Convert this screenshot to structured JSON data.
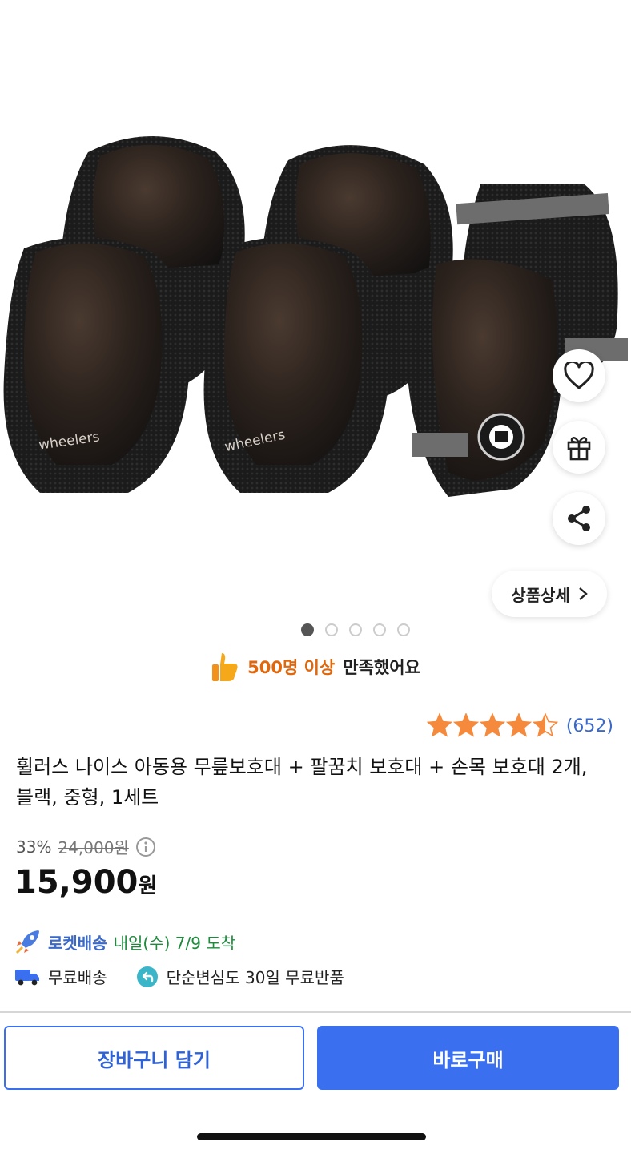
{
  "product_image": {
    "brand_mark_1": "wheelers",
    "brand_mark_2": "wheelers"
  },
  "actions": {
    "wishlist_icon": "heart-icon",
    "gift_icon": "gift-icon",
    "share_icon": "share-icon",
    "detail_label": "상품상세"
  },
  "carousel": {
    "count": 5,
    "active_index": 0
  },
  "satisfaction": {
    "highlight": "500명 이상",
    "rest": "만족했어요"
  },
  "rating": {
    "stars": 4.5,
    "count_text": "(652)"
  },
  "product": {
    "title": "휠러스 나이스 아동용 무릎보호대 + 팔꿈치 보호대 + 손목 보호대 2개, 블랙, 중형, 1세트"
  },
  "price": {
    "discount": "33%",
    "original": "24,000원",
    "current": "15,900",
    "currency": "원"
  },
  "delivery": {
    "brand": "로켓배송",
    "eta": "내일(수) 7/9 도착",
    "free_shipping": "무료배송",
    "return_policy": "단순변심도 30일 무료반품"
  },
  "buttons": {
    "cart": "장바구니 담기",
    "buy": "바로구매"
  },
  "colors": {
    "accent": "#3a6ff0",
    "star": "#f58a3c",
    "highlight": "#e0670c"
  }
}
